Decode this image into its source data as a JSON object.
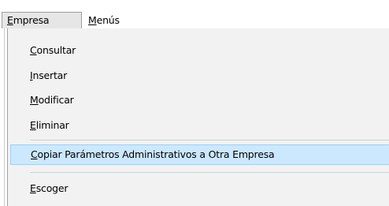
{
  "menubar": {
    "items": [
      {
        "label": "Empresa",
        "mnemonic": "E",
        "rest": "mpresa",
        "state": "open"
      },
      {
        "label": "Menús",
        "mnemonic": "M",
        "rest": "enús",
        "state": "closed"
      }
    ]
  },
  "dropdown": {
    "items": [
      {
        "label": "Consultar",
        "mnemonic": "C",
        "rest": "onsultar"
      },
      {
        "label": "Insertar",
        "mnemonic": "I",
        "rest": "nsertar"
      },
      {
        "label": "Modificar",
        "mnemonic": "M",
        "rest": "odificar"
      },
      {
        "label": "Eliminar",
        "mnemonic": "E",
        "rest": "liminar"
      },
      {
        "label": "Copiar Parámetros Administrativos a Otra Empresa",
        "mnemonic": "C",
        "rest": "opiar Parámetros Administrativos a Otra Empresa",
        "highlighted": true
      },
      {
        "label": "Escoger",
        "mnemonic": "E",
        "rest": "scoger"
      }
    ]
  }
}
